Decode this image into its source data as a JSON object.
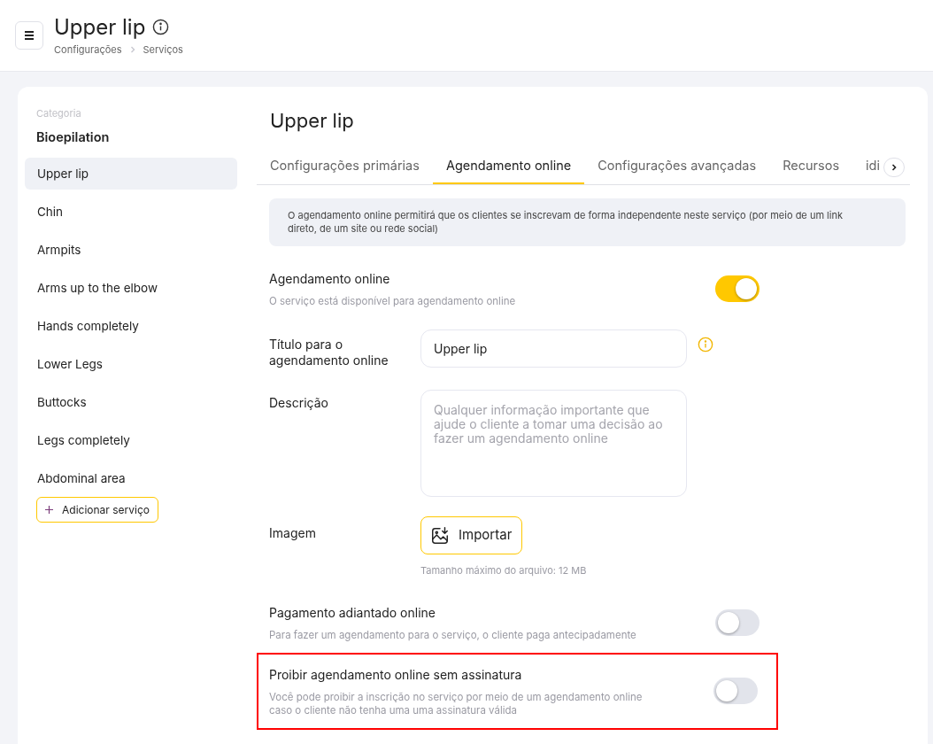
{
  "header": {
    "title": "Upper lip",
    "breadcrumbs": [
      "Configurações",
      "Serviços"
    ]
  },
  "sidebar": {
    "caption": "Categoria",
    "category": "Bioepilation",
    "items": [
      {
        "label": "Upper lip",
        "selected": true
      },
      {
        "label": "Chin",
        "selected": false
      },
      {
        "label": "Armpits",
        "selected": false
      },
      {
        "label": "Arms up to the elbow",
        "selected": false
      },
      {
        "label": "Hands completely",
        "selected": false
      },
      {
        "label": "Lower Legs",
        "selected": false
      },
      {
        "label": "Buttocks",
        "selected": false
      },
      {
        "label": "Legs completely",
        "selected": false
      },
      {
        "label": "Abdominal area",
        "selected": false
      }
    ],
    "add_button": "Adicionar serviço"
  },
  "main": {
    "title": "Upper lip",
    "tabs": [
      {
        "label": "Configurações primárias",
        "selected": false
      },
      {
        "label": "Agendamento online",
        "selected": true
      },
      {
        "label": "Configurações avançadas",
        "selected": false
      },
      {
        "label": "Recursos",
        "selected": false
      },
      {
        "label": "idi",
        "selected": false
      }
    ],
    "notice": "O agendamento online permitirá que os clientes se inscrevam de forma independente neste serviço (por meio de um link direto, de um site ou rede social)",
    "settings": [
      {
        "kind": "toggle",
        "label": "Agendamento online",
        "description": "O serviço está disponível para agendamento online",
        "on": true,
        "highlighted": false
      },
      {
        "kind": "text",
        "label": "Título para o agendamento online",
        "value": "Upper lip"
      },
      {
        "kind": "textarea",
        "label": "Descrição",
        "placeholder": "Qualquer informação importante que ajude o cliente a tomar uma decisão ao fazer um agendamento online"
      },
      {
        "kind": "upload",
        "label": "Imagem",
        "button": "Importar",
        "hint": "Tamanho máximo do arquivo: 12 MB"
      },
      {
        "kind": "toggle",
        "label": "Pagamento adiantado online",
        "description": "Para fazer um agendamento para o serviço, o cliente paga antecipadamente",
        "on": false,
        "highlighted": false
      },
      {
        "kind": "toggle",
        "label": "Proibir agendamento online sem assinatura",
        "description": "Você pode proibir a inscrição no serviço por meio de um agendamento online caso o cliente não tenha uma uma assinatura válida",
        "on": false,
        "highlighted": true
      }
    ]
  }
}
